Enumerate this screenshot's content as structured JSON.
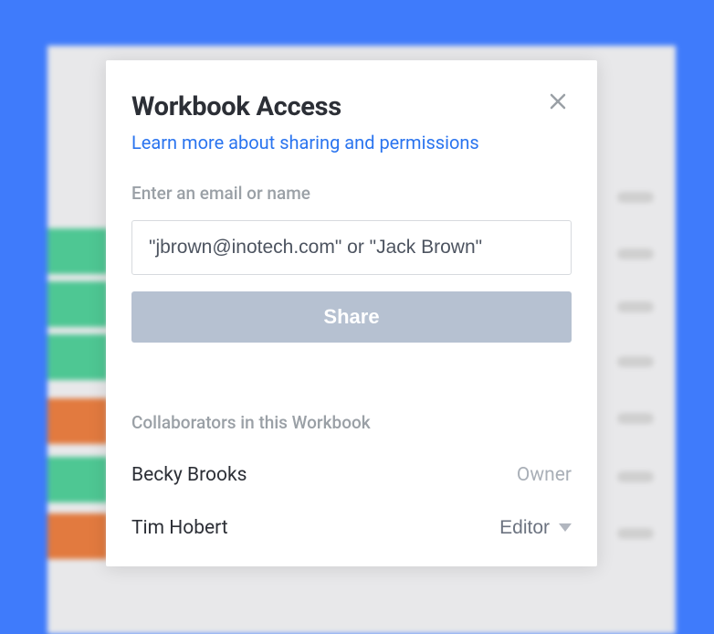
{
  "modal": {
    "title": "Workbook Access",
    "learn_more": "Learn more about sharing and permissions",
    "field_label": "Enter an email or name",
    "input_placeholder": "\"jbrown@inotech.com\" or \"Jack Brown\"",
    "share_label": "Share",
    "collaborators_label": "Collaborators in this Workbook",
    "collaborators": [
      {
        "name": "Becky Brooks",
        "role": "Owner",
        "editable": false
      },
      {
        "name": "Tim Hobert",
        "role": "Editor",
        "editable": true
      }
    ]
  }
}
